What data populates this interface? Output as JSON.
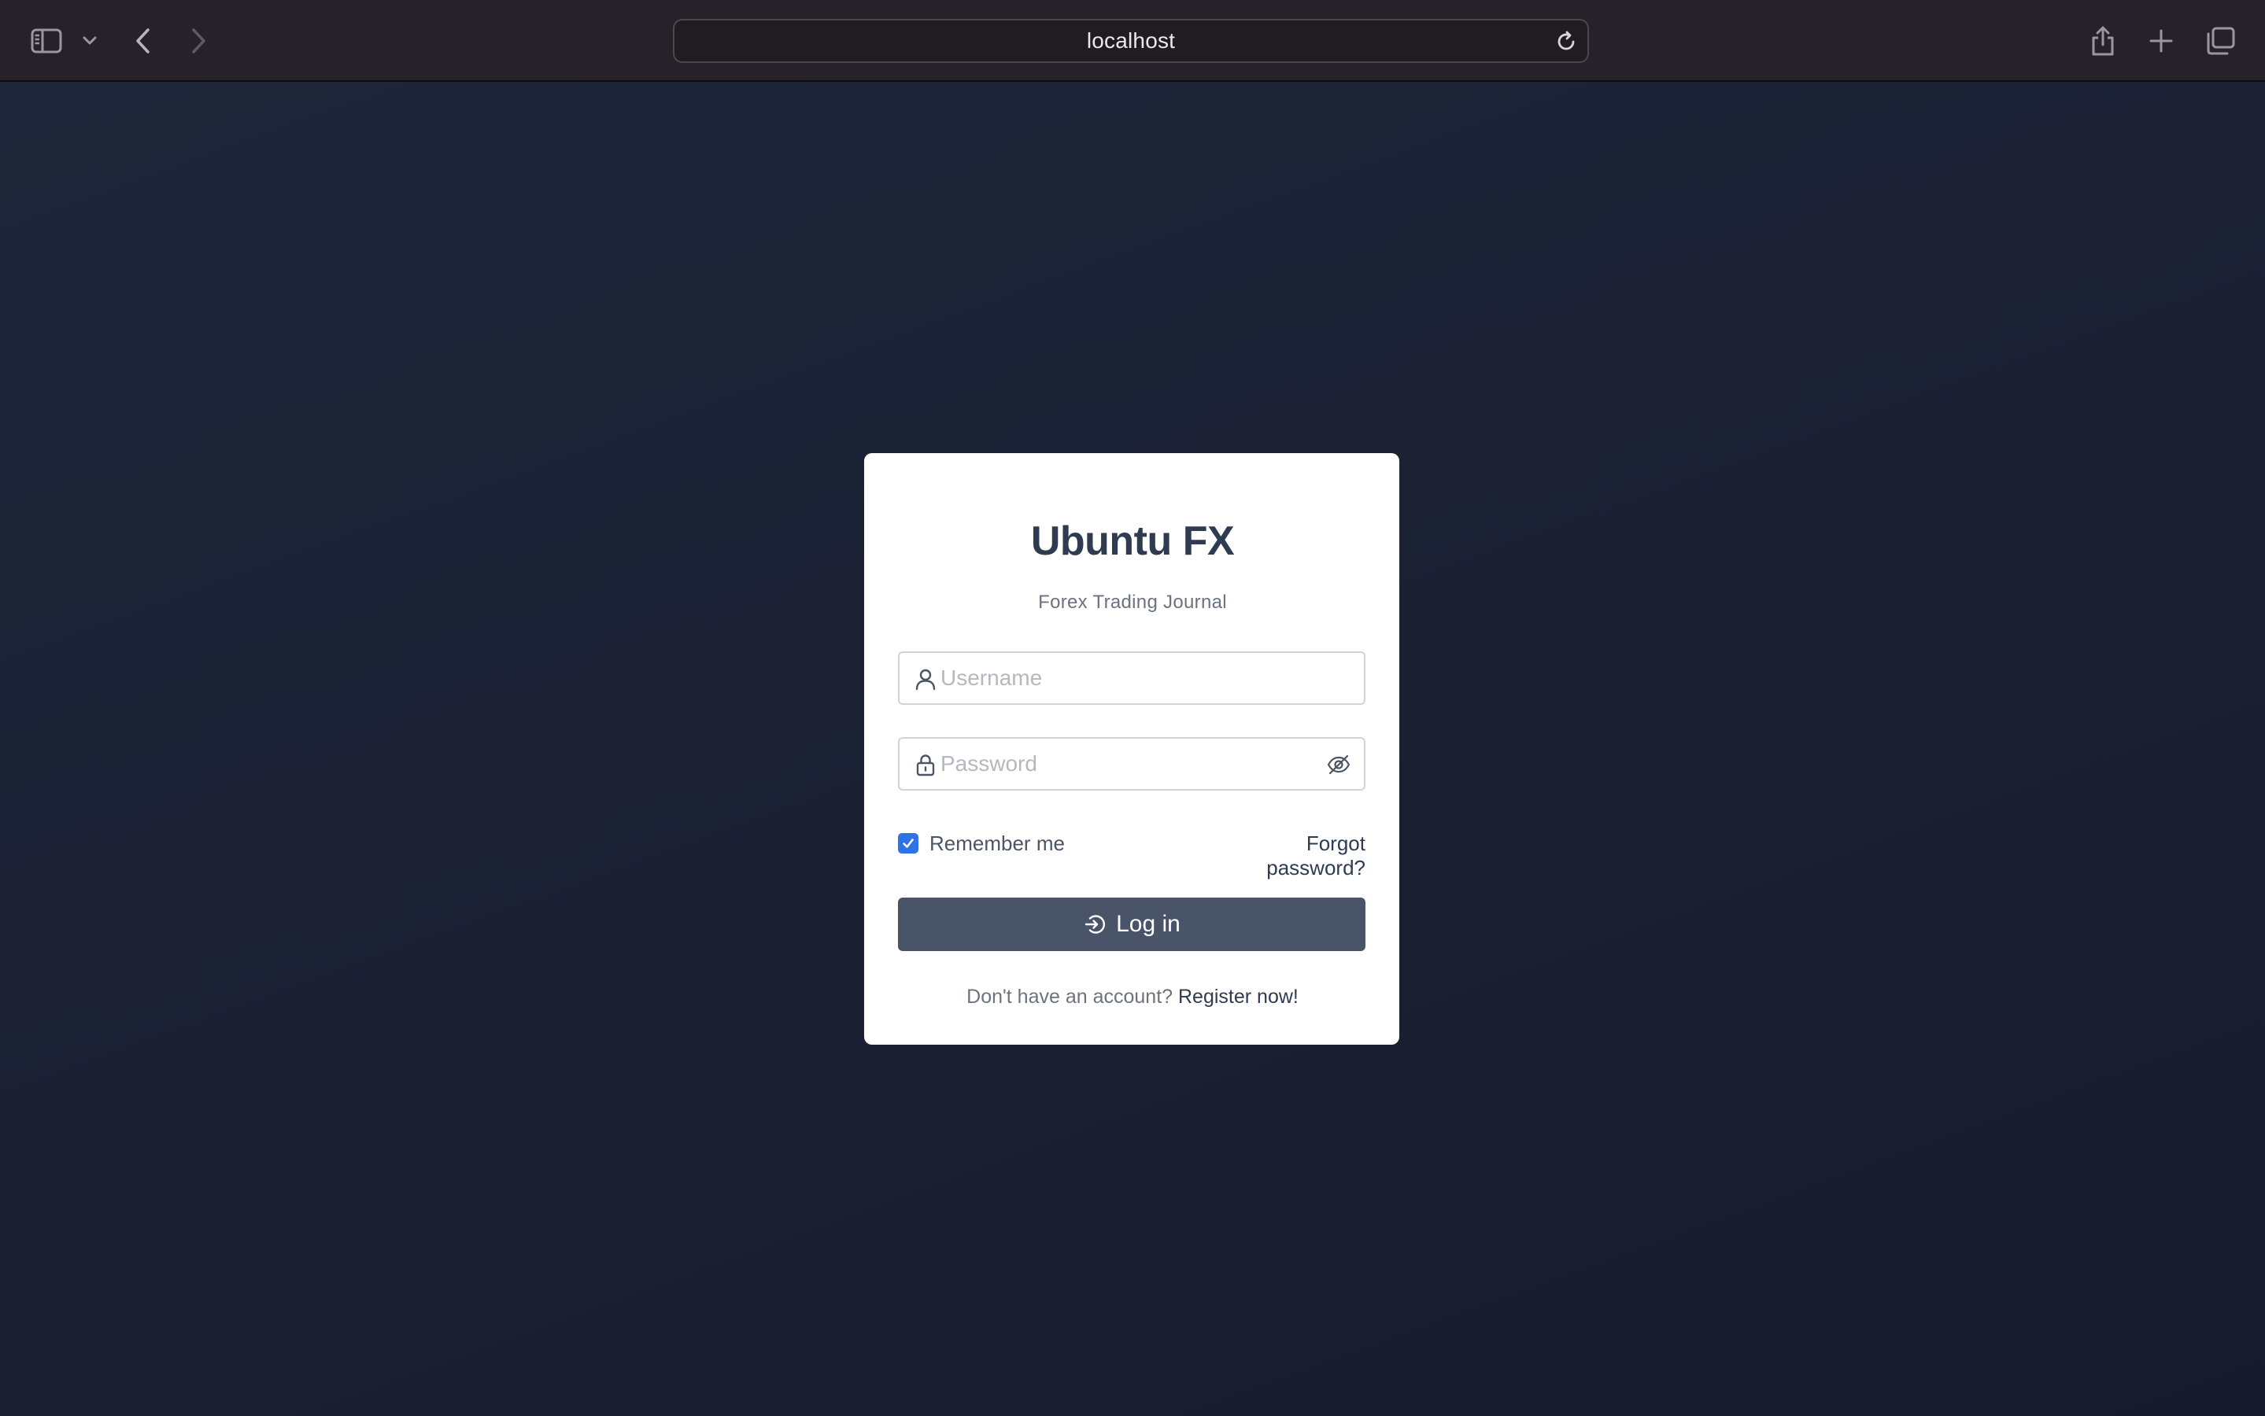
{
  "browser": {
    "url": "localhost",
    "icons": {
      "sidebar": "sidebar-icon",
      "tab_group_menu": "chevron-down-icon",
      "back": "chevron-left-icon",
      "forward": "chevron-right-icon",
      "reload": "reload-icon",
      "share": "share-icon",
      "new_tab": "plus-icon",
      "tab_overview": "tabs-overview-icon"
    }
  },
  "login": {
    "app_title": "Ubuntu FX",
    "subtitle": "Forex Trading Journal",
    "username": {
      "value": "",
      "placeholder": "Username",
      "icon": "user-icon"
    },
    "password": {
      "value": "",
      "placeholder": "Password",
      "icon": "lock-icon",
      "toggle_icon": "eye-slash-icon"
    },
    "remember_me": {
      "label": "Remember me",
      "checked": true
    },
    "forgot_password": "Forgot password?",
    "login_button": {
      "label": "Log in",
      "icon": "login-icon"
    },
    "register_prompt": "Don't have an account?",
    "register_link": "Register now!"
  },
  "colors": {
    "page_background": "#1c2336",
    "card_background": "#ffffff",
    "title_text": "#2f3b50",
    "button_background": "#4a5468",
    "checkbox_accent": "#2e73e6",
    "browser_toolbar": "#25222a"
  }
}
